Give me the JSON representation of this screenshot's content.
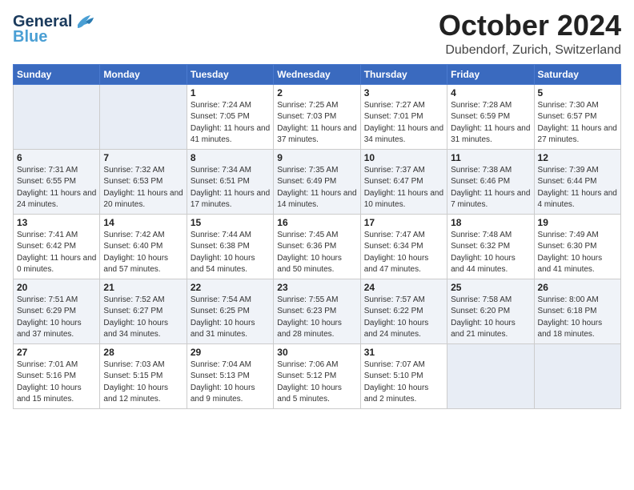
{
  "header": {
    "logo_general": "General",
    "logo_blue": "Blue",
    "title": "October 2024",
    "subtitle": "Dubendorf, Zurich, Switzerland"
  },
  "weekdays": [
    "Sunday",
    "Monday",
    "Tuesday",
    "Wednesday",
    "Thursday",
    "Friday",
    "Saturday"
  ],
  "weeks": [
    [
      {
        "day": "",
        "info": ""
      },
      {
        "day": "",
        "info": ""
      },
      {
        "day": "1",
        "info": "Sunrise: 7:24 AM\nSunset: 7:05 PM\nDaylight: 11 hours and 41 minutes."
      },
      {
        "day": "2",
        "info": "Sunrise: 7:25 AM\nSunset: 7:03 PM\nDaylight: 11 hours and 37 minutes."
      },
      {
        "day": "3",
        "info": "Sunrise: 7:27 AM\nSunset: 7:01 PM\nDaylight: 11 hours and 34 minutes."
      },
      {
        "day": "4",
        "info": "Sunrise: 7:28 AM\nSunset: 6:59 PM\nDaylight: 11 hours and 31 minutes."
      },
      {
        "day": "5",
        "info": "Sunrise: 7:30 AM\nSunset: 6:57 PM\nDaylight: 11 hours and 27 minutes."
      }
    ],
    [
      {
        "day": "6",
        "info": "Sunrise: 7:31 AM\nSunset: 6:55 PM\nDaylight: 11 hours and 24 minutes."
      },
      {
        "day": "7",
        "info": "Sunrise: 7:32 AM\nSunset: 6:53 PM\nDaylight: 11 hours and 20 minutes."
      },
      {
        "day": "8",
        "info": "Sunrise: 7:34 AM\nSunset: 6:51 PM\nDaylight: 11 hours and 17 minutes."
      },
      {
        "day": "9",
        "info": "Sunrise: 7:35 AM\nSunset: 6:49 PM\nDaylight: 11 hours and 14 minutes."
      },
      {
        "day": "10",
        "info": "Sunrise: 7:37 AM\nSunset: 6:47 PM\nDaylight: 11 hours and 10 minutes."
      },
      {
        "day": "11",
        "info": "Sunrise: 7:38 AM\nSunset: 6:46 PM\nDaylight: 11 hours and 7 minutes."
      },
      {
        "day": "12",
        "info": "Sunrise: 7:39 AM\nSunset: 6:44 PM\nDaylight: 11 hours and 4 minutes."
      }
    ],
    [
      {
        "day": "13",
        "info": "Sunrise: 7:41 AM\nSunset: 6:42 PM\nDaylight: 11 hours and 0 minutes."
      },
      {
        "day": "14",
        "info": "Sunrise: 7:42 AM\nSunset: 6:40 PM\nDaylight: 10 hours and 57 minutes."
      },
      {
        "day": "15",
        "info": "Sunrise: 7:44 AM\nSunset: 6:38 PM\nDaylight: 10 hours and 54 minutes."
      },
      {
        "day": "16",
        "info": "Sunrise: 7:45 AM\nSunset: 6:36 PM\nDaylight: 10 hours and 50 minutes."
      },
      {
        "day": "17",
        "info": "Sunrise: 7:47 AM\nSunset: 6:34 PM\nDaylight: 10 hours and 47 minutes."
      },
      {
        "day": "18",
        "info": "Sunrise: 7:48 AM\nSunset: 6:32 PM\nDaylight: 10 hours and 44 minutes."
      },
      {
        "day": "19",
        "info": "Sunrise: 7:49 AM\nSunset: 6:30 PM\nDaylight: 10 hours and 41 minutes."
      }
    ],
    [
      {
        "day": "20",
        "info": "Sunrise: 7:51 AM\nSunset: 6:29 PM\nDaylight: 10 hours and 37 minutes."
      },
      {
        "day": "21",
        "info": "Sunrise: 7:52 AM\nSunset: 6:27 PM\nDaylight: 10 hours and 34 minutes."
      },
      {
        "day": "22",
        "info": "Sunrise: 7:54 AM\nSunset: 6:25 PM\nDaylight: 10 hours and 31 minutes."
      },
      {
        "day": "23",
        "info": "Sunrise: 7:55 AM\nSunset: 6:23 PM\nDaylight: 10 hours and 28 minutes."
      },
      {
        "day": "24",
        "info": "Sunrise: 7:57 AM\nSunset: 6:22 PM\nDaylight: 10 hours and 24 minutes."
      },
      {
        "day": "25",
        "info": "Sunrise: 7:58 AM\nSunset: 6:20 PM\nDaylight: 10 hours and 21 minutes."
      },
      {
        "day": "26",
        "info": "Sunrise: 8:00 AM\nSunset: 6:18 PM\nDaylight: 10 hours and 18 minutes."
      }
    ],
    [
      {
        "day": "27",
        "info": "Sunrise: 7:01 AM\nSunset: 5:16 PM\nDaylight: 10 hours and 15 minutes."
      },
      {
        "day": "28",
        "info": "Sunrise: 7:03 AM\nSunset: 5:15 PM\nDaylight: 10 hours and 12 minutes."
      },
      {
        "day": "29",
        "info": "Sunrise: 7:04 AM\nSunset: 5:13 PM\nDaylight: 10 hours and 9 minutes."
      },
      {
        "day": "30",
        "info": "Sunrise: 7:06 AM\nSunset: 5:12 PM\nDaylight: 10 hours and 5 minutes."
      },
      {
        "day": "31",
        "info": "Sunrise: 7:07 AM\nSunset: 5:10 PM\nDaylight: 10 hours and 2 minutes."
      },
      {
        "day": "",
        "info": ""
      },
      {
        "day": "",
        "info": ""
      }
    ]
  ]
}
